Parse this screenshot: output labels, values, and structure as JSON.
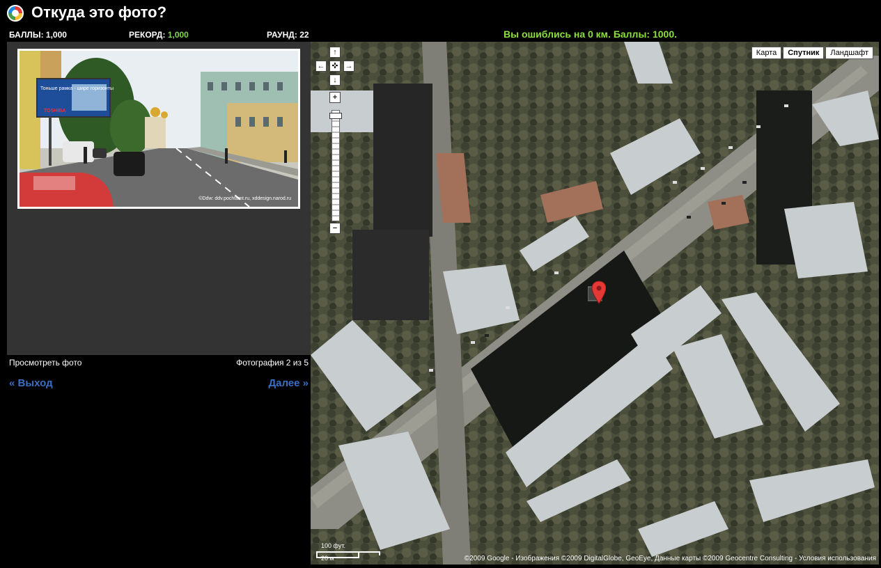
{
  "app": {
    "title": "Откуда это фото?"
  },
  "stats": {
    "score_label": "БАЛЛЫ:",
    "score_value": "1,000",
    "record_label": "РЕКОРД:",
    "record_value": "1,000",
    "round_label": "РАУНД:",
    "round_value": "22"
  },
  "result": {
    "message": "Вы ошиблись на 0 км. Баллы: 1000."
  },
  "photo": {
    "credit": "©Ddw: ddv.pochtamt.ru, xddesign.narod.ru",
    "billboard_text": "Тоньше рамка - шире горизонты",
    "billboard_brand": "TOSHIBA"
  },
  "panel": {
    "view_photo": "Просмотреть фото",
    "counter": "Фотография 2 из 5",
    "exit": "« Выход",
    "next": "Далее »"
  },
  "map": {
    "types": [
      "Карта",
      "Спутник",
      "Ландшафт"
    ],
    "active_type": "Спутник",
    "controls": {
      "up": "↑",
      "left": "←",
      "center": "✜",
      "right": "→",
      "down": "↓",
      "zoom_in": "+",
      "zoom_out": "−"
    },
    "scale_ft": "100 фут.",
    "scale_m": "20 м",
    "copyright": "©2009 Google - Изображения ©2009 DigitalGlobe, GeoEye, Данные карты ©2009 Geocentre Consulting - Условия использования"
  },
  "colors": {
    "accent_green": "#8be03b",
    "link_blue": "#3a6fc4",
    "panel_bg": "#333333"
  }
}
